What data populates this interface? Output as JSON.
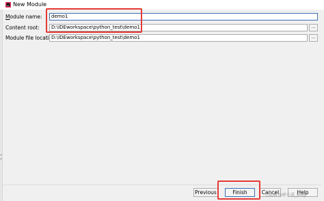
{
  "window": {
    "title": "New Module",
    "icon": "intellij-app-icon"
  },
  "form": {
    "module_name": {
      "label_mnemonic": "M",
      "label_rest": "odule name:",
      "value": "demo1"
    },
    "content_root": {
      "label": "Content root:",
      "value": "D:\\IDEworkspace\\python_test\\demo1",
      "browse_label": "..."
    },
    "module_file_location": {
      "label": "Module file location:",
      "value": "D:\\IDEworkspace\\python_test\\demo1",
      "browse_label": "..."
    }
  },
  "buttons": {
    "previous": "Previous",
    "finish": "Finish",
    "cancel": "Cancel",
    "help": "Help"
  },
  "annotations": {
    "highlight_color": "#e53935"
  },
  "watermark": "CSDN @虾小语_Blog"
}
